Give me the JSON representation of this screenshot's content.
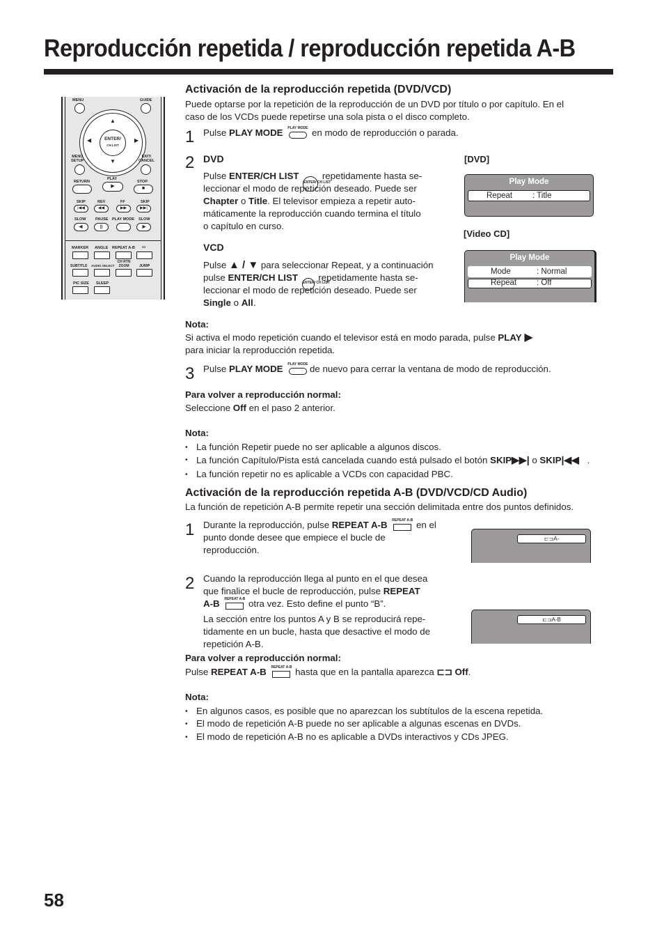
{
  "page": {
    "title": "Reproducción repetida / reproducción repetida A-B",
    "page_number": "58"
  },
  "remote": {
    "top_labels": [
      "MENU",
      "GUIDE"
    ],
    "enter_label_1": "ENTER/",
    "enter_label_2": "CH LIST",
    "menu_setup": "MENU\nSETUP",
    "exit_cancel": "EXIT/\nCANCEL",
    "row1": [
      "RETURN",
      "PLAY",
      "STOP"
    ],
    "row2": [
      "SKIP",
      "REV",
      "FF",
      "SKIP"
    ],
    "row3": [
      "SLOW",
      "PAUSE",
      "PLAY MODE",
      "SLOW"
    ],
    "row4": [
      "MARKER",
      "ANGLE",
      "REPEAT A-B",
      "▭"
    ],
    "row5": [
      "SUBTITLE",
      "AUDIO SELECT",
      "CH RTN ZOOM",
      "JUMP"
    ],
    "row6": [
      "PIC SIZE",
      "SLEEP"
    ]
  },
  "section1": {
    "heading": "Activación de la reproducción repetida (DVD/VCD)",
    "intro_line1": "Puede optarse por la repetición de la reproducción de un DVD por título o por capítulo. En el",
    "intro_line2": "caso de los VCDs puede repetirse una sola pista o el disco completo.",
    "step1": {
      "num": "1",
      "pre": "Pulse ",
      "bold": "PLAY MODE",
      "icon_label": "PLAY MODE",
      "post": " en modo de reproducción o parada."
    },
    "step2": {
      "num": "2",
      "dvd_heading": "DVD",
      "dvd_l1_pre": "Pulse ",
      "dvd_l1_bold": "ENTER/CH LIST",
      "dvd_l1_post": " repetidamente hasta se-",
      "dvd_l2": "leccionar el modo de repetición deseado. Puede ser",
      "dvd_l3_b1": "Chapter",
      "dvd_l3_o": " o ",
      "dvd_l3_b2": "Title",
      "dvd_l3_post": ". El televisor empieza a repetir auto-",
      "dvd_l4": "máticamente la reproducción cuando termina el título",
      "dvd_l5": "o capítulo en curso.",
      "vcd_heading": "VCD",
      "vcd_l1_pre": "Pulse ",
      "vcd_l1_arrows": "▲ / ▼",
      "vcd_l1_post": " para seleccionar Repeat, y a continuación",
      "vcd_l2_pre": "pulse ",
      "vcd_l2_bold": "ENTER/CH LIST",
      "vcd_l2_post": " repetidamente hasta se-",
      "vcd_l3": "leccionar el modo de repetición deseado. Puede ser",
      "vcd_l4_b1": "Single",
      "vcd_l4_o": " o ",
      "vcd_l4_b2": "All",
      "vcd_l4_post": "."
    },
    "enter_icon_label": "ENTER/ CH LIST",
    "osd_dvd": {
      "caption": "[DVD]",
      "title": "Play Mode",
      "row_key": "Repeat",
      "row_value": ": Title"
    },
    "osd_vcd": {
      "caption": "[Video CD]",
      "title": "Play Mode",
      "row1_key": "Mode",
      "row1_value": ": Normal",
      "row2_key": "Repeat",
      "row2_value": ": Off"
    },
    "nota1": {
      "label": "Nota:",
      "l1_pre": "Si activa el modo repetición cuando el televisor está en modo parada, pulse ",
      "l1_bold": "PLAY",
      "l2": "para iniciar la reproducción repetida."
    },
    "step3": {
      "num": "3",
      "pre": "Pulse ",
      "bold": "PLAY MODE",
      "post": " de nuevo para cerrar la ventana de modo de reproducción."
    },
    "normal": {
      "label": "Para volver a reproducción normal:",
      "pre": "Seleccione ",
      "bold": "Off",
      "post": " en el paso 2 anterior."
    },
    "nota2": {
      "label": "Nota:",
      "b1": "La función Repetir puede no ser aplicable a algunos discos.",
      "b2_pre": "La función Capítulo/Pista está cancelada cuando está pulsado el botón ",
      "b2_skip": "SKIP",
      "b2_o": " o ",
      "b2_end": ".",
      "b3": "La función repetir no es aplicable a VCDs con capacidad PBC."
    }
  },
  "section2": {
    "heading": "Activación de la reproducción repetida A-B (DVD/VCD/CD Audio)",
    "intro": "La función de repetición A-B permite repetir una sección delimitada entre dos puntos definidos.",
    "icon_label": "REPEAT A-B",
    "step1": {
      "num": "1",
      "l1_pre": "Durante la reproducción, pulse ",
      "l1_bold": "REPEAT A-B",
      "l1_post": " en el",
      "l2": "punto donde desee que empiece el bucle de",
      "l3": "reproducción."
    },
    "step2": {
      "num": "2",
      "l1": "Cuando la reproducción llega al punto en el que desea",
      "l2_pre": "que finalice el bucle de reproducción, pulse ",
      "l2_bold": "REPEAT",
      "l3_bold": "A-B",
      "l3_post": " otra vez. Esto define el punto “B”.",
      "l4": "La sección entre los puntos A y B se reproducirá repe-",
      "l5": "tidamente en un bucle, hasta que desactive el modo de",
      "l6": "repetición A-B."
    },
    "osd1_text": "A-",
    "osd2_text": "A-B",
    "normal": {
      "label": "Para volver a reproducción normal:",
      "pre": "Pulse ",
      "bold": "REPEAT A-B",
      "mid": " hasta que en la pantalla aparezca ",
      "off": "Off",
      "end": "."
    },
    "nota": {
      "label": "Nota:",
      "b1": "En algunos casos, es posible que no aparezcan los subtítulos de la escena repetida.",
      "b2": "El modo de repetición A-B puede no ser aplicable a algunas escenas en DVDs.",
      "b3": "El modo de repetición A-B no es aplicable a DVDs interactivos y CDs JPEG."
    }
  }
}
